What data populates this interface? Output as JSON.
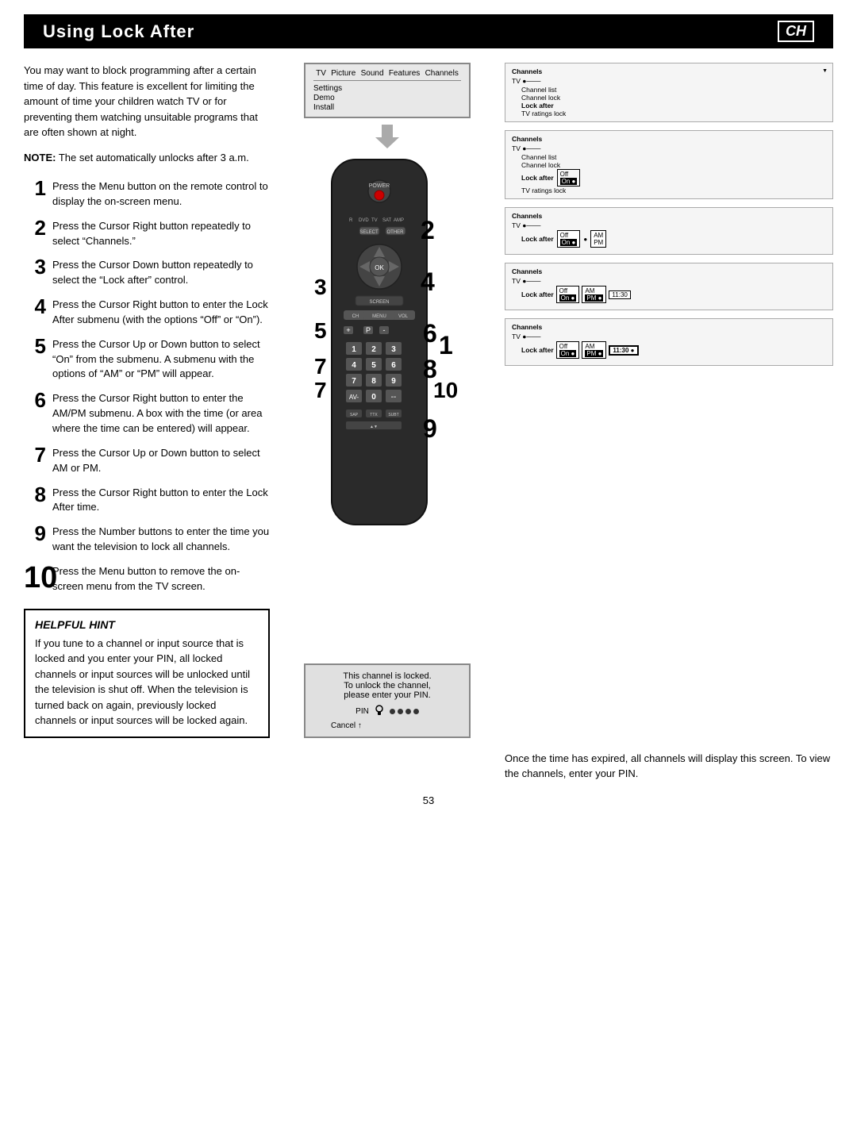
{
  "header": {
    "title": "Using Lock After",
    "chapter": "CH"
  },
  "intro": "You may want to block programming after a certain time of day. This feature is excellent for limiting the amount of time your children watch TV or for preventing them watching unsuitable programs that are often shown at night.",
  "note": "NOTE: The set automatically unlocks after 3 a.m.",
  "steps": [
    {
      "num": "1",
      "large": false,
      "text": "Press the Menu button on the remote control to display the on-screen menu."
    },
    {
      "num": "2",
      "large": false,
      "text": "Press the Cursor Right button repeatedly to select “Channels.”"
    },
    {
      "num": "3",
      "large": false,
      "text": "Press the Cursor Down button repeatedly to select the “Lock after” control."
    },
    {
      "num": "4",
      "large": false,
      "text": "Press the Cursor Right button to enter the Lock After submenu (with the options “Off” or “On”)."
    },
    {
      "num": "5",
      "large": false,
      "text": "Press the Cursor Up or Down button to select “On” from the submenu. A submenu with the options of “AM” or “PM” will appear."
    },
    {
      "num": "6",
      "large": false,
      "text": "Press the Cursor Right button to enter the AM/PM submenu. A box with the time (or area where the time can be entered) will appear."
    },
    {
      "num": "7",
      "large": false,
      "text": "Press the Cursor Up or Down button to select AM or PM."
    },
    {
      "num": "8",
      "large": false,
      "text": "Press the Cursor Right button to enter the Lock After time."
    },
    {
      "num": "9",
      "large": false,
      "text": "Press the Number buttons to enter the time you want the television to lock all channels."
    },
    {
      "num": "10",
      "large": true,
      "text": "Press the Menu button to remove the on-screen menu from the TV screen."
    }
  ],
  "helpful_hint": {
    "title": "Helpful Hint",
    "text": "If you tune to a channel or input source that is locked and you enter your PIN, all locked channels or input sources will be unlocked until the television is shut off. When the television is turned back on again, previously locked channels or input sources will be locked again."
  },
  "once_time_text": "Once the time has expired, all channels will display this screen. To view the channels, enter your PIN.",
  "page_number": "53",
  "tv_menu": {
    "top_items": [
      "Picture",
      "Sound",
      "Features",
      "Channels"
    ],
    "tv_label": "TV",
    "side_items": [
      "Settings",
      "Demo",
      "Install"
    ]
  },
  "channels_menus": [
    {
      "id": "menu1",
      "channels_label": "Channels",
      "tv_label": "TV",
      "items": [
        "Channel list",
        "Channel lock",
        "Lock after",
        "TV ratings lock"
      ],
      "arrows": [
        true,
        false,
        false,
        false
      ]
    },
    {
      "id": "menu2",
      "channels_label": "Channels",
      "tv_label": "TV",
      "items": [
        "Channel list",
        "Channel lock",
        "Lock after",
        "TV ratings lock"
      ],
      "lock_after_options": {
        "off": "Off",
        "on": "On"
      },
      "lock_after_selected": "on"
    },
    {
      "id": "menu3",
      "channels_label": "Channels",
      "tv_label": "TV",
      "lock_after_label": "Lock after",
      "submenu": [
        "Off",
        "On"
      ],
      "submenu_selected": "On",
      "am_pm_options": [
        "AM",
        "PM"
      ]
    },
    {
      "id": "menu4",
      "channels_label": "Channels",
      "tv_label": "TV",
      "lock_after_label": "Lock after",
      "submenu_selected": "On",
      "am_pm_selected": "PM",
      "time_value": "11:30"
    },
    {
      "id": "menu5",
      "channels_label": "Channels",
      "tv_label": "TV",
      "lock_after_label": "Lock after",
      "submenu_selected": "On",
      "am_pm_selected": "PM",
      "time_value": "11:30",
      "time_selected": true
    }
  ],
  "lock_screen": {
    "line1": "This channel is locked.",
    "line2": "To unlock the channel,",
    "line3": "please enter your PIN.",
    "pin_label": "PIN",
    "cancel_label": "Cancel"
  }
}
